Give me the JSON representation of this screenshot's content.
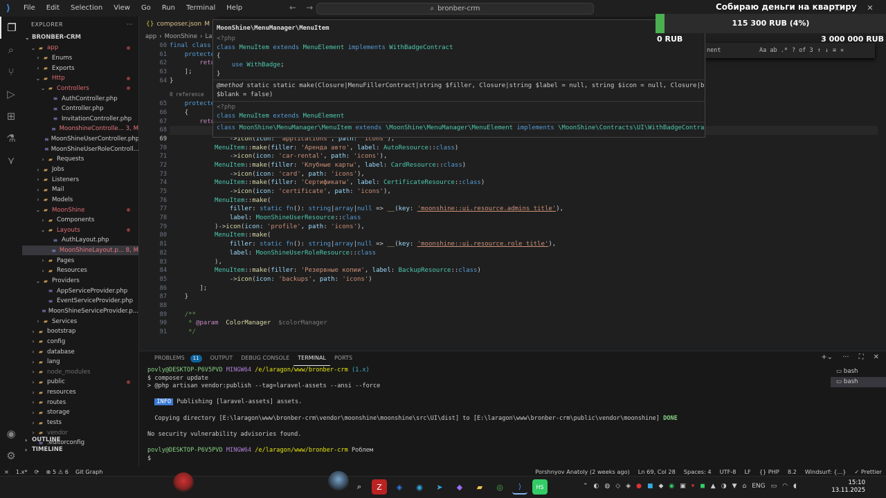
{
  "titlebar": {
    "menu": [
      "File",
      "Edit",
      "Selection",
      "View",
      "Go",
      "Run",
      "Terminal",
      "Help"
    ],
    "search": "bronber-crm"
  },
  "donation": {
    "title": "Собираю деньги на квартиру",
    "progress_text": "115 300 RUB (4%)",
    "progress_fraction": 0.04,
    "min": "0 RUB",
    "max": "3 000 000 RUB",
    "fill_color": "#4caf50"
  },
  "sidebar": {
    "header": "EXPLORER",
    "root": "BRONBER-CRM",
    "tree": [
      {
        "label": "app",
        "depth": 1,
        "open": true,
        "folder": true,
        "cls": "c-app",
        "dot": true
      },
      {
        "label": "Enums",
        "depth": 2,
        "folder": true
      },
      {
        "label": "Exports",
        "depth": 2,
        "folder": true
      },
      {
        "label": "Http",
        "depth": 2,
        "open": true,
        "folder": true,
        "cls": "c-app",
        "dot": true
      },
      {
        "label": "Controllers",
        "depth": 3,
        "open": true,
        "folder": true,
        "cls": "c-app",
        "dot": true
      },
      {
        "label": "AuthController.php",
        "depth": 4
      },
      {
        "label": "Controller.php",
        "depth": 4
      },
      {
        "label": "InvitationController.php",
        "depth": 4
      },
      {
        "label": "MoonshineControlle... 3, M",
        "depth": 4,
        "cls": "c-mod"
      },
      {
        "label": "MoonShineUserController.php",
        "depth": 4
      },
      {
        "label": "MoonShineUserRoleControll...",
        "depth": 4
      },
      {
        "label": "Requests",
        "depth": 3,
        "folder": true
      },
      {
        "label": "Jobs",
        "depth": 2,
        "folder": true
      },
      {
        "label": "Listeners",
        "depth": 2,
        "folder": true
      },
      {
        "label": "Mail",
        "depth": 2,
        "folder": true
      },
      {
        "label": "Models",
        "depth": 2,
        "folder": true
      },
      {
        "label": "MoonShine",
        "depth": 2,
        "open": true,
        "folder": true,
        "cls": "c-app",
        "dot": true
      },
      {
        "label": "Components",
        "depth": 3,
        "folder": true
      },
      {
        "label": "Layouts",
        "depth": 3,
        "open": true,
        "folder": true,
        "cls": "c-app",
        "dot": true
      },
      {
        "label": "AuthLayout.php",
        "depth": 4
      },
      {
        "label": "MoonShineLayout.p... 8, M",
        "depth": 4,
        "cls": "c-mod",
        "sel": true
      },
      {
        "label": "Pages",
        "depth": 3,
        "folder": true
      },
      {
        "label": "Resources",
        "depth": 3,
        "folder": true
      },
      {
        "label": "Providers",
        "depth": 2,
        "open": true,
        "folder": true
      },
      {
        "label": "AppServiceProvider.php",
        "depth": 3
      },
      {
        "label": "EventServiceProvider.php",
        "depth": 3
      },
      {
        "label": "MoonShineServiceProvider.p...",
        "depth": 3
      },
      {
        "label": "Services",
        "depth": 2,
        "folder": true
      },
      {
        "label": "bootstrap",
        "depth": 1,
        "folder": true
      },
      {
        "label": "config",
        "depth": 1,
        "folder": true
      },
      {
        "label": "database",
        "depth": 1,
        "folder": true
      },
      {
        "label": "lang",
        "depth": 1,
        "folder": true
      },
      {
        "label": "node_modules",
        "depth": 1,
        "folder": true,
        "cls": "c-dim"
      },
      {
        "label": "public",
        "depth": 1,
        "folder": true,
        "dot": true
      },
      {
        "label": "resources",
        "depth": 1,
        "folder": true
      },
      {
        "label": "routes",
        "depth": 1,
        "folder": true
      },
      {
        "label": "storage",
        "depth": 1,
        "folder": true
      },
      {
        "label": "tests",
        "depth": 1,
        "folder": true
      },
      {
        "label": "vendor",
        "depth": 1,
        "folder": true,
        "cls": "c-dim"
      },
      {
        "label": ".editorconfig",
        "depth": 1
      }
    ],
    "outline": "OUTLINE",
    "timeline": "TIMELINE"
  },
  "tabs": [
    {
      "label": "composer.json",
      "flag": "M"
    }
  ],
  "breadcrumb": [
    "app",
    "MoonShine",
    "Layo"
  ],
  "editor": {
    "line_numbers": [
      "60",
      "61",
      "62",
      "63",
      "64",
      "65",
      "66",
      "67",
      "68",
      "69",
      "70",
      "71",
      "72",
      "73",
      "74",
      "75",
      "76",
      "77",
      "78",
      "79",
      "80",
      "81",
      "82",
      "83",
      "84",
      "85",
      "86",
      "87",
      "88",
      "89",
      "90",
      "91"
    ],
    "current_line_number": "69",
    "references_hint": "0 reference"
  },
  "hover": {
    "title": "MoonShine\\MenuManager\\MenuItem",
    "lines": [
      "<?php",
      "class MenuItem extends MenuElement implements WithBadgeContract",
      "{",
      "    use WithBadge;",
      "}",
      "@method static static make(Closure|MenuFillerContract|string $filler, Closure|string $label = null, string $icon = null, Closure|bool",
      "$blank = false)",
      "<?php",
      "class MenuItem extends MenuElement",
      "",
      "class MoonShine\\MenuManager\\MenuItem extends \\MoonShine\\MenuManager\\MenuElement implements \\MoonShine\\Contracts\\UI\\WithBadgeContract"
    ]
  },
  "find_widget": {
    "label": "nent",
    "result": "? of 3",
    "options": "Aa ab .*"
  },
  "panel": {
    "tabs": [
      "PROBLEMS",
      "OUTPUT",
      "DEBUG CONSOLE",
      "TERMINAL",
      "PORTS"
    ],
    "problems_count": "11",
    "terminals": [
      "bash",
      "bash"
    ]
  },
  "terminal": {
    "user": "povly@DESKTOP-P6V5PVD",
    "shell": "MINGW64",
    "path": "/e/laragon/www/bronber-crm",
    "branch": "(1.x)",
    "cmd1": "$ composer update",
    "cmd2": "> @php artisan vendor:publish --tag=laravel-assets --ansi --force",
    "info_tag": "INFO",
    "info_text": " Publishing [laravel-assets] assets.",
    "copy_text": "  Copying directory [E:\\laragon\\www\\bronber-crm\\vendor\\moonshine\\moonshine\\src\\UI\\dist] to [E:\\laragon\\www\\bronber-crm\\public\\vendor\\moonshine]",
    "done": "DONE",
    "no_vuln": "No security vulnerability advisories found.",
    "prompt2_user": "povly@DESKTOP-P6V5PVD",
    "prompt2_branch": "Роблем",
    "prompt_symbol": "$"
  },
  "statusbar": {
    "left": [
      "⨯",
      "1.x*",
      "⟳",
      "⊗ 5  ⚠ 6",
      "Git Graph"
    ],
    "right": [
      "Porshnyov Anatoly (2 weeks ago)",
      "Ln 69, Col 28",
      "Spaces: 4",
      "UTF-8",
      "LF",
      "{} PHP",
      "8.2",
      "Windsurf: {...}",
      "✓ Prettier"
    ]
  },
  "taskbar": {
    "lang": "ENG",
    "time": "15:10",
    "date": "13.11.2025"
  }
}
